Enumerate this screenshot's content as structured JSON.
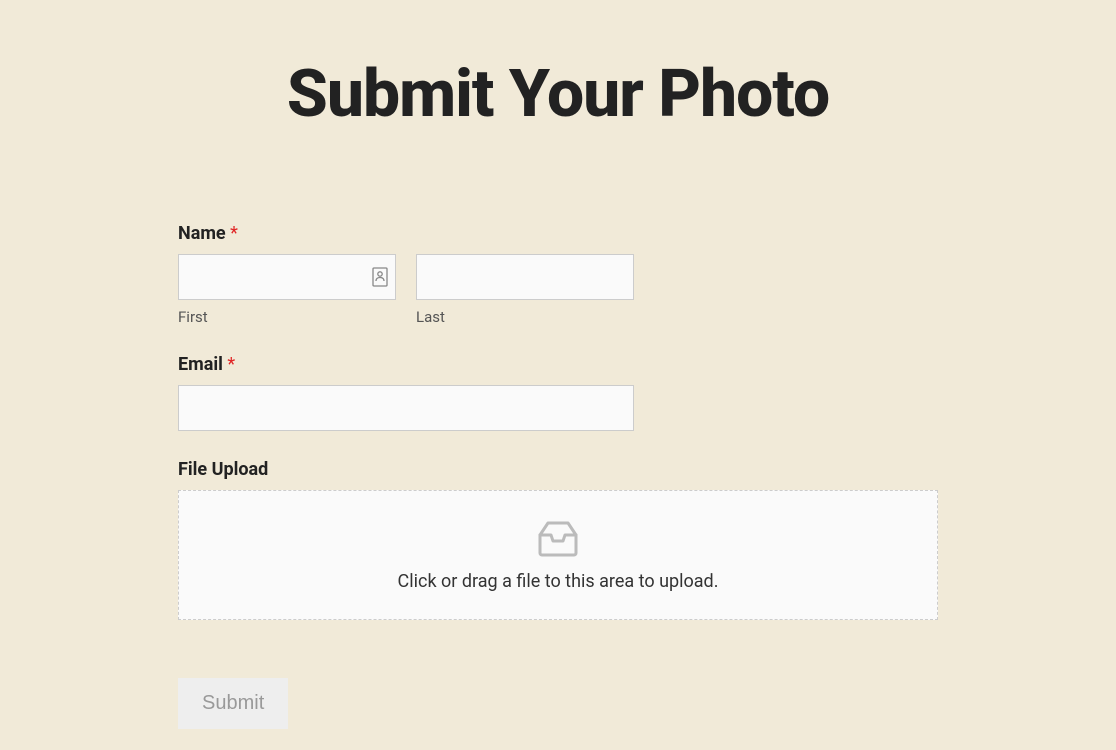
{
  "page": {
    "title": "Submit Your Photo"
  },
  "form": {
    "name": {
      "label": "Name ",
      "required_mark": "*",
      "first_sublabel": "First",
      "last_sublabel": "Last",
      "first_value": "",
      "last_value": ""
    },
    "email": {
      "label": "Email ",
      "required_mark": "*",
      "value": ""
    },
    "file_upload": {
      "label": "File Upload",
      "dropzone_text": "Click or drag a file to this area to upload."
    },
    "submit_label": "Submit"
  }
}
